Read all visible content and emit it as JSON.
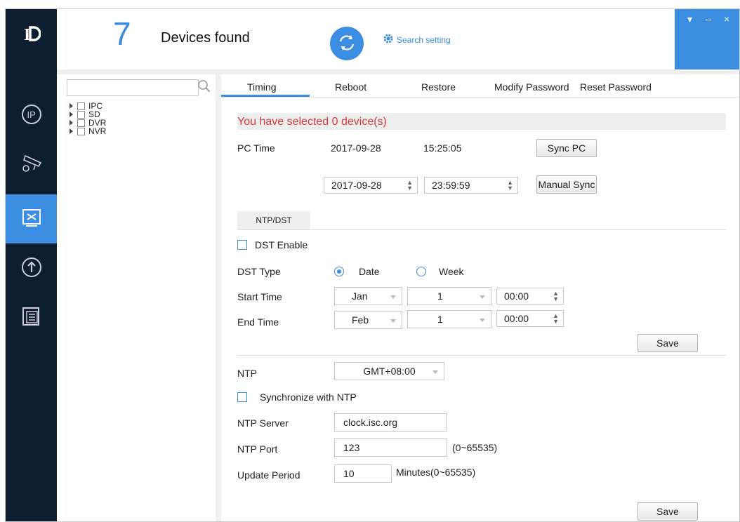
{
  "header": {
    "device_count": "7",
    "device_count_label": "Devices found",
    "search_setting": "Search setting"
  },
  "window_controls": [
    "▾",
    "–",
    "×"
  ],
  "sidebar": {
    "items": [
      {
        "icon": "ip-icon",
        "active": false
      },
      {
        "icon": "camera-settings-icon",
        "active": false
      },
      {
        "icon": "tools-icon",
        "active": true
      },
      {
        "icon": "upgrade-icon",
        "active": false
      },
      {
        "icon": "document-icon",
        "active": false
      }
    ]
  },
  "tree": {
    "search_placeholder": "",
    "items": [
      {
        "label": "IPC"
      },
      {
        "label": "SD"
      },
      {
        "label": "DVR"
      },
      {
        "label": "NVR"
      }
    ]
  },
  "tabs": [
    {
      "label": "Timing",
      "active": true
    },
    {
      "label": "Reboot"
    },
    {
      "label": "Restore"
    },
    {
      "label": "Modify Password"
    },
    {
      "label": "Reset Password"
    }
  ],
  "timing": {
    "selected_msg": "You have selected 0 device(s)",
    "pc_time_label": "PC Time",
    "pc_date": "2017-09-28",
    "pc_time": "15:25:05",
    "sync_pc_button": "Sync PC",
    "manual_date": "2017-09-28",
    "manual_time": "23:59:59",
    "manual_sync_button": "Manual Sync",
    "subtab": "NTP/DST",
    "dst_enable_label": "DST Enable",
    "dst_type_label": "DST Type",
    "dst_type_date": "Date",
    "dst_type_week": "Week",
    "start_time_label": "Start Time",
    "start_month": "Jan",
    "start_day": "1",
    "start_time": "00:00",
    "end_time_label": "End Time",
    "end_month": "Feb",
    "end_day": "1",
    "end_time": "00:00",
    "save_button": "Save",
    "ntp_label": "NTP",
    "ntp_zone": "GMT+08:00",
    "sync_ntp_label": "Synchronize with NTP",
    "ntp_server_label": "NTP Server",
    "ntp_server_value": "clock.isc.org",
    "ntp_port_label": "NTP Port",
    "ntp_port_value": "123",
    "ntp_port_range": "(0~65535)",
    "update_period_label": "Update Period",
    "update_period_value": "10",
    "update_period_unit": "Minutes(0~65535)",
    "save_button_2": "Save"
  },
  "colors": {
    "accent": "#3a8de0",
    "sidebar": "#0e1e30",
    "warning_text": "#d83a3a"
  }
}
